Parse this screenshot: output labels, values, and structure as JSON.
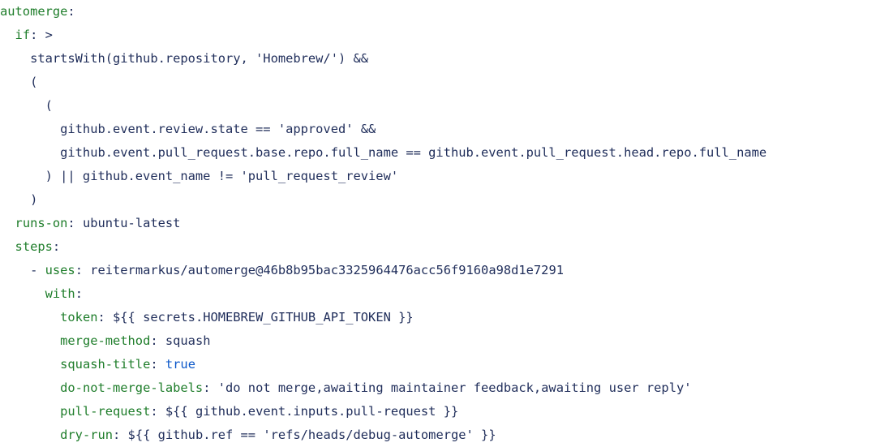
{
  "code_lines": [
    [
      {
        "cls": "k",
        "text": "automerge"
      },
      {
        "cls": "t",
        "text": ":"
      }
    ],
    [
      {
        "cls": "t",
        "text": "  "
      },
      {
        "cls": "k",
        "text": "if"
      },
      {
        "cls": "t",
        "text": ": >"
      }
    ],
    [
      {
        "cls": "t",
        "text": "    startsWith(github.repository, 'Homebrew/') &&"
      }
    ],
    [
      {
        "cls": "t",
        "text": "    ("
      }
    ],
    [
      {
        "cls": "t",
        "text": "      ("
      }
    ],
    [
      {
        "cls": "t",
        "text": "        github.event.review.state == 'approved' &&"
      }
    ],
    [
      {
        "cls": "t",
        "text": "        github.event.pull_request.base.repo.full_name == github.event.pull_request.head.repo.full_name"
      }
    ],
    [
      {
        "cls": "t",
        "text": "      ) || github.event_name != 'pull_request_review'"
      }
    ],
    [
      {
        "cls": "t",
        "text": "    )"
      }
    ],
    [
      {
        "cls": "t",
        "text": "  "
      },
      {
        "cls": "k",
        "text": "runs-on"
      },
      {
        "cls": "t",
        "text": ": ubuntu-latest"
      }
    ],
    [
      {
        "cls": "t",
        "text": "  "
      },
      {
        "cls": "k",
        "text": "steps"
      },
      {
        "cls": "t",
        "text": ":"
      }
    ],
    [
      {
        "cls": "t",
        "text": "    - "
      },
      {
        "cls": "k",
        "text": "uses"
      },
      {
        "cls": "t",
        "text": ": reitermarkus/automerge@46b8b95bac3325964476acc56f9160a98d1e7291"
      }
    ],
    [
      {
        "cls": "t",
        "text": "      "
      },
      {
        "cls": "k",
        "text": "with"
      },
      {
        "cls": "t",
        "text": ":"
      }
    ],
    [
      {
        "cls": "t",
        "text": "        "
      },
      {
        "cls": "k",
        "text": "token"
      },
      {
        "cls": "t",
        "text": ": ${{ secrets.HOMEBREW_GITHUB_API_TOKEN }}"
      }
    ],
    [
      {
        "cls": "t",
        "text": "        "
      },
      {
        "cls": "k",
        "text": "merge-method"
      },
      {
        "cls": "t",
        "text": ": squash"
      }
    ],
    [
      {
        "cls": "t",
        "text": "        "
      },
      {
        "cls": "k",
        "text": "squash-title"
      },
      {
        "cls": "t",
        "text": ": "
      },
      {
        "cls": "b",
        "text": "true"
      }
    ],
    [
      {
        "cls": "t",
        "text": "        "
      },
      {
        "cls": "k",
        "text": "do-not-merge-labels"
      },
      {
        "cls": "t",
        "text": ": 'do not merge,awaiting maintainer feedback,awaiting user reply'"
      }
    ],
    [
      {
        "cls": "t",
        "text": "        "
      },
      {
        "cls": "k",
        "text": "pull-request"
      },
      {
        "cls": "t",
        "text": ": ${{ github.event.inputs.pull-request }}"
      }
    ],
    [
      {
        "cls": "t",
        "text": "        "
      },
      {
        "cls": "k",
        "text": "dry-run"
      },
      {
        "cls": "t",
        "text": ": ${{ github.ref == 'refs/heads/debug-automerge' }}"
      }
    ]
  ]
}
